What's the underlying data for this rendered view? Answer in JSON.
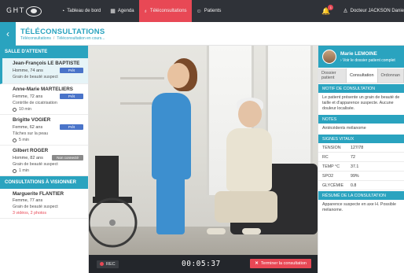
{
  "nav": {
    "logo_text": "GHT",
    "items": [
      {
        "label": "Tableau de bord",
        "icon": "dashboard-icon"
      },
      {
        "label": "Agenda",
        "icon": "calendar-icon"
      },
      {
        "label": "Téléconsultations",
        "icon": "stethoscope-icon",
        "active": true
      },
      {
        "label": "Patients",
        "icon": "users-icon"
      }
    ],
    "notification_count": "1",
    "user_name": "Docteur JACKSON Danie"
  },
  "header": {
    "title": "TÉLÉCONSULTATIONS",
    "breadcrumb": [
      "Téléconsultations",
      "Téléconsultation en cours..."
    ]
  },
  "sidebar": {
    "waiting_title": "SALLE D'ATTENTE",
    "waiting": [
      {
        "name": "Jean-François LE BAPTISTE",
        "info": "Homme, 74 ans",
        "status": "Prêt",
        "reason": "Grain de beauté suspect",
        "wait": ""
      },
      {
        "name": "Anne-Marie MARTELIERS",
        "info": "Femme, 72 ans",
        "status": "Prêt",
        "reason": "Contrôle de cicatrisation",
        "wait": "10 min"
      },
      {
        "name": "Brigitte VOGIER",
        "info": "Femme, 62 ans",
        "status": "Prêt",
        "reason": "Tâches sur la peau",
        "wait": "5 min"
      },
      {
        "name": "Gilbert ROGER",
        "info": "Homme, 82 ans",
        "status": "Non connecté",
        "reason": "Grain de beauté suspect",
        "wait": "1 min"
      }
    ],
    "review_title": "CONSULTATIONS À VISIONNER",
    "review": [
      {
        "name": "Marguerite FLANTIER",
        "info": "Femme, 77 ans",
        "reason": "Grain de beauté suspect",
        "extra": "3 vidéos, 2 photos"
      }
    ]
  },
  "video": {
    "rec_label": "REC",
    "timer": "00:05:37",
    "end_label": "Terminer la consultation"
  },
  "patient_panel": {
    "name": "Marie LEMOINE",
    "link": "› Voir le dossier patient complet",
    "tabs": [
      "Dossier patient",
      "Consultation",
      "Ordonnan"
    ],
    "motif_title": "MOTIF DE CONSULTATION",
    "motif_text": "Le patient présente un grain de beauté de taille et d'apparence suspecte. Aucune douleur localisée.",
    "notes_title": "NOTES",
    "notes_text": "Antécédents mélanome",
    "vitals_title": "SIGNES VITAUX",
    "vitals": [
      {
        "label": "TENSION",
        "value": "127/78"
      },
      {
        "label": "RC",
        "value": "72"
      },
      {
        "label": "TEMP °C",
        "value": "37.1"
      },
      {
        "label": "SPO2",
        "value": "99%"
      },
      {
        "label": "GLYCÉMIE",
        "value": "0.8"
      }
    ],
    "summary_title": "RÉSUMÉ DE LA CONSULTATION",
    "summary_text": "Apparence suspecte en axe H. Possible mélanome."
  },
  "colors": {
    "accent": "#2aa3bf",
    "danger": "#e84855",
    "nav_bg": "#2f3238",
    "badge_ready": "#4a74c9"
  }
}
